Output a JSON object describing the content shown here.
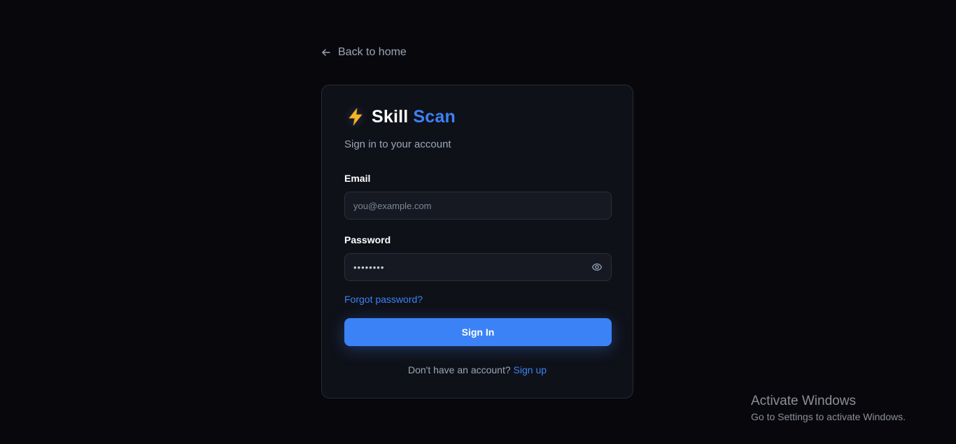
{
  "nav": {
    "back_label": "Back to home",
    "back_icon": "arrow-left-icon"
  },
  "brand": {
    "icon": "lightning-bolt-icon",
    "word1": "Skill",
    "word2": "Scan",
    "accent_color": "#3b82f6"
  },
  "form": {
    "subtitle": "Sign in to your account",
    "email_label": "Email",
    "email_placeholder": "you@example.com",
    "email_value": "",
    "password_label": "Password",
    "password_value": "••••••••",
    "password_toggle_icon": "eye-icon",
    "forgot_label": "Forgot password?",
    "submit_label": "Sign In",
    "no_account_text": "Don't have an account?",
    "signup_label": "Sign up"
  },
  "watermark": {
    "title": "Activate Windows",
    "subtitle": "Go to Settings to activate Windows."
  },
  "colors": {
    "background": "#08080c",
    "card": "#0f1118",
    "primary": "#3b82f6",
    "muted_text": "#9ba6b8"
  }
}
